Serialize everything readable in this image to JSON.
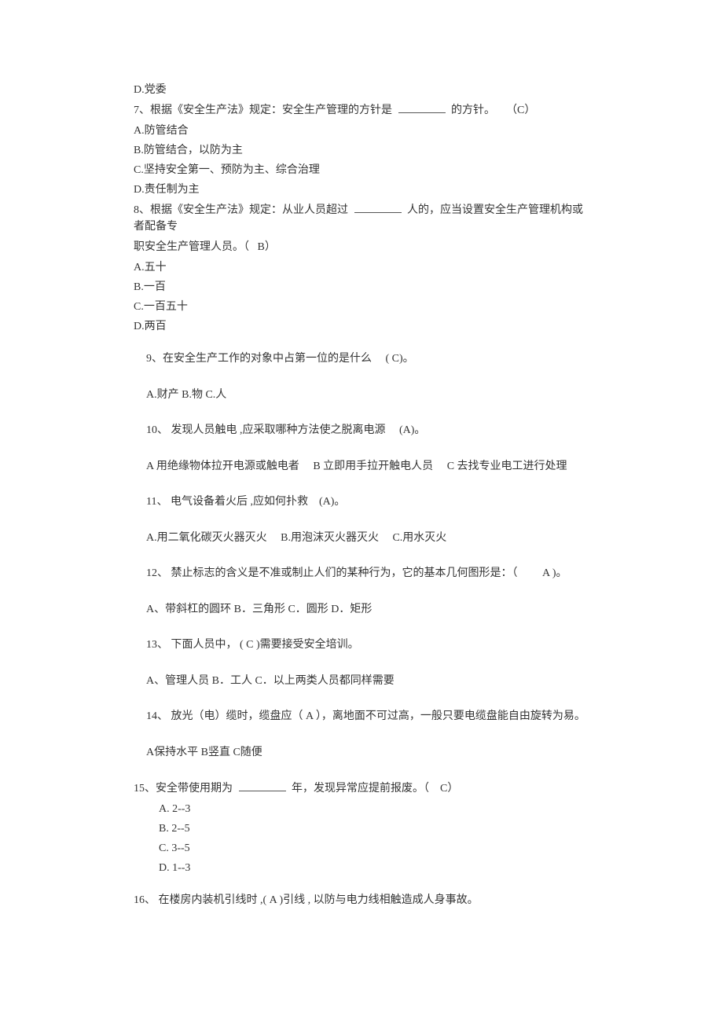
{
  "q6_optD": "D.党委",
  "q7": {
    "stem_a": "7、根据《安全生产法》规定：安全生产管理的方针是",
    "stem_b": "的方针。",
    "ans": "（C）",
    "A": "A.防管结合",
    "B": "B.防管结合，以防为主",
    "C": "C.坚持安全第一、预防为主、综合治理",
    "D": "D.责任制为主"
  },
  "q8": {
    "stem_a": "8、根据《安全生产法》规定：从业人员超过",
    "stem_b": "人的，应当设置安全生产管理机构或者配备专",
    "stem_c": "职安全生产管理人员。（",
    "stem_d": "B）",
    "A": "A.五十",
    "B": "B.一百",
    "C": "C.一百五十",
    "D": "D.两百"
  },
  "q9": {
    "stem": "9、在安全生产工作的对象中占第一位的是什么",
    "ans": "( C)。",
    "opts": "A.财产  B.物 C.人"
  },
  "q10": {
    "stem": "10、 发现人员触电 ,应采取哪种方法使之脱离电源",
    "ans": "(A)。",
    "A": "A 用绝缘物体拉开电源或触电者",
    "B": "B 立即用手拉开触电人员",
    "C": "C 去找专业电工进行处理"
  },
  "q11": {
    "stem": "11、 电气设备着火后 ,应如何扑救",
    "ans": "(A)。",
    "A": "A.用二氧化碳灭火器灭火",
    "B": "B.用泡沫灭火器灭火",
    "C": "C.用水灭火"
  },
  "q12": {
    "stem": "12、 禁止标志的含义是不准或制止人们的某种行为，它的基本几何图形是：（",
    "ans": "A )。",
    "opts": "A、带斜杠的圆环   B．三角形   C．圆形   D．矩形"
  },
  "q13": {
    "stem": "13、 下面人员中，  ( C )需要接受安全培训。",
    "opts": "A、管理人员   B．工人   C．以上两类人员都同样需要"
  },
  "q14": {
    "stem": "14、 放光（电）缆时，缆盘应（   A  ），离地面不可过高，一般只要电缆盘能自由旋转为易。",
    "opts": "A保持水平     B竖直     C随便"
  },
  "q15": {
    "stem_a": "15、安全带使用期为",
    "stem_b": "年，发现异常应提前报废。（",
    "ans": "C）",
    "A": "A. 2--3",
    "B": "B. 2--5",
    "C": "C. 3--5",
    "D": "D. 1--3"
  },
  "q16": {
    "stem": "16、 在楼房内装机引线时    ,( A )引线 , 以防与电力线相触造成人身事故。"
  }
}
